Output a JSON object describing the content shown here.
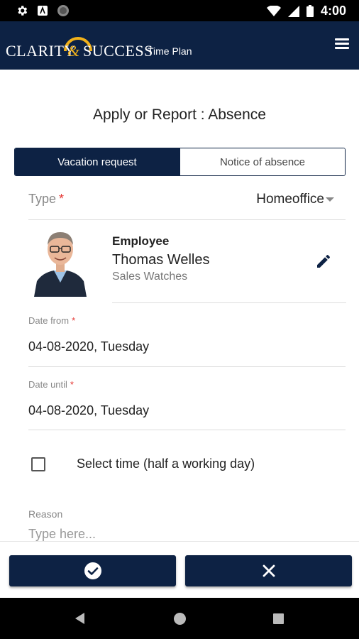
{
  "status_bar": {
    "time": "4:00",
    "left_icons": [
      "gear-icon",
      "app-icon",
      "circle-icon"
    ],
    "right_icons": [
      "wifi-icon",
      "signal-icon",
      "battery-icon"
    ]
  },
  "app_bar": {
    "brand_word_1": "CLARITY",
    "brand_ampersand": "&",
    "brand_word_2": "SUCCESS",
    "brand_sub": "Time Plan",
    "menu_icon": "hamburger-menu-icon"
  },
  "page": {
    "title": "Apply or Report : Absence"
  },
  "segmented": {
    "active_label": "Vacation request",
    "inactive_label": "Notice of absence"
  },
  "type_field": {
    "label": "Type",
    "required_mark": "*",
    "value": "Homeoffice"
  },
  "employee": {
    "label": "Employee",
    "name": "Thomas Welles",
    "department": "Sales Watches",
    "edit_icon": "pencil-icon"
  },
  "date_from": {
    "label": "Date from",
    "required_mark": "*",
    "value": "04-08-2020, Tuesday"
  },
  "date_until": {
    "label": "Date until",
    "required_mark": "*",
    "value": "04-08-2020, Tuesday"
  },
  "select_time": {
    "label": "Select time (half a working day)",
    "checked": false
  },
  "reason": {
    "label": "Reason",
    "placeholder": "Type here..."
  },
  "actions": {
    "confirm_icon": "check-circle-icon",
    "cancel_icon": "close-icon"
  },
  "colors": {
    "primary": "#0d2244",
    "accent_gold": "#f2b21a",
    "required": "#e53935"
  }
}
